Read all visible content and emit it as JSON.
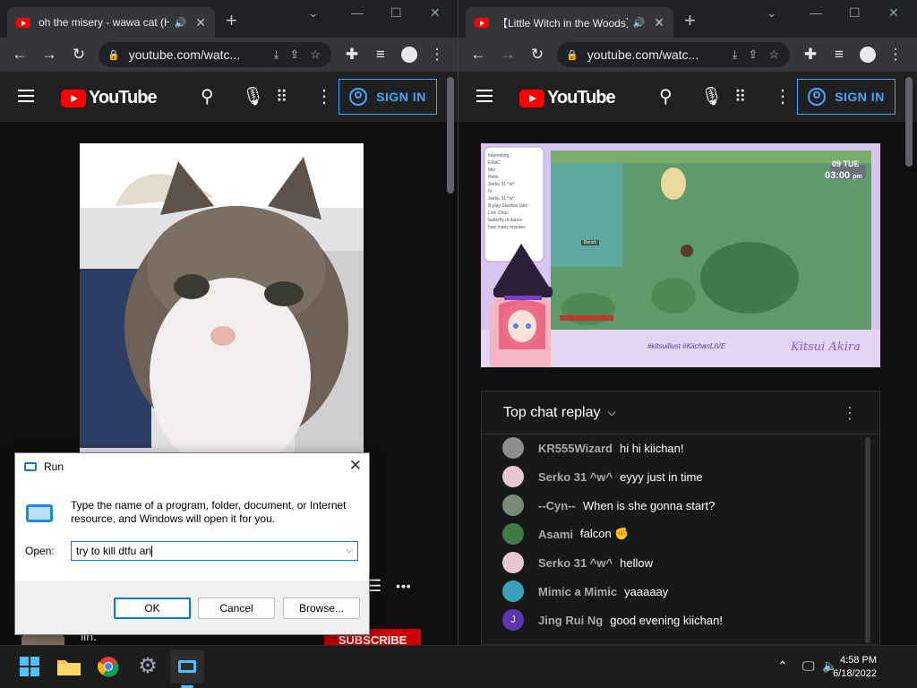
{
  "left_window": {
    "tab_title": "oh the misery - wawa cat (H",
    "url": "youtube.com/watc...",
    "signin_label": "SIGN IN",
    "logo_text": "YouTube",
    "channel_partial": "iin.",
    "subscribe_label": "SUBSCRIBE",
    "more_label": "•••",
    "equals_label": "☰"
  },
  "right_window": {
    "tab_title": "【Little Witch in the Woods】",
    "url": "youtube.com/watc...",
    "signin_label": "SIGN IN",
    "logo_text": "YouTube",
    "stream": {
      "overlay_chat": [
        "Interesting.",
        "ERAC",
        "Mei",
        "Hello",
        "Serko 31 ^w^",
        "hi",
        "Serko 31 ^w^",
        "ill play Stardew later",
        "Lion Chan",
        "butterfly di dance",
        "how many minutes"
      ],
      "hud_day": "09 TUE",
      "hud_time": "03:00",
      "hud_time_suffix": "pm",
      "npc_label": "Bench",
      "hashtags": "#kitsuillust #KiichanLIVE",
      "brand": "Kitsui Akira"
    },
    "chat": {
      "header": "Top chat replay",
      "messages": [
        {
          "author": "KR555Wizard",
          "text": "hi hi kiichan!",
          "color": "#8d8d8d"
        },
        {
          "author": "Serko 31 ^w^",
          "text": "eyyy just in time",
          "color": "#e8c8d0"
        },
        {
          "author": "--Cyn--",
          "text": "When is she gonna start?",
          "color": "#7a8a7a"
        },
        {
          "author": "Asami",
          "text": "falcon ✊",
          "color": "#3f7a4a"
        },
        {
          "author": "Serko 31 ^w^",
          "text": "hellow",
          "color": "#e8c8d0"
        },
        {
          "author": "Mimic a Mimic",
          "text": "yaaaaay",
          "color": "#3aa0b8"
        },
        {
          "author": "Jing Rui Ng",
          "text": "good evening kiichan!",
          "color": "#5e35b1",
          "initial": "J"
        }
      ]
    }
  },
  "run_dialog": {
    "title": "Run",
    "description": "Type the name of a program, folder, document, or Internet resource, and Windows will open it for you.",
    "open_label": "Open:",
    "input_value": "try to kill dtfu an",
    "ok_label": "OK",
    "cancel_label": "Cancel",
    "browse_label": "Browse..."
  },
  "taskbar": {
    "time": "4:58 PM",
    "date": "6/18/2022"
  },
  "colors": {
    "youtube_red": "#ff0000",
    "signin_blue": "#3ea6ff",
    "windows_blue": "#0078d4"
  }
}
